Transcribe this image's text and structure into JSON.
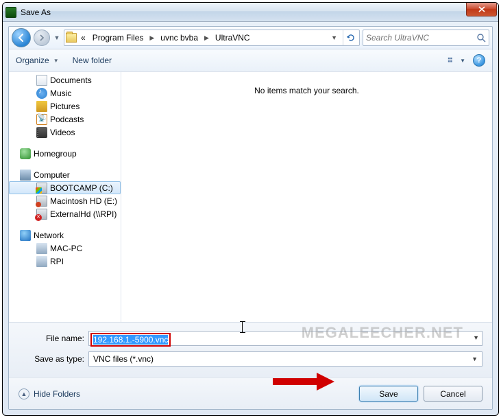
{
  "window": {
    "title": "Save As"
  },
  "breadcrumbs": {
    "prefix": "«",
    "items": [
      "Program Files",
      "uvnc bvba",
      "UltraVNC"
    ]
  },
  "search": {
    "placeholder": "Search UltraVNC"
  },
  "toolbar": {
    "organize": "Organize",
    "newfolder": "New folder"
  },
  "sidebar": {
    "libs": [
      "Documents",
      "Music",
      "Pictures",
      "Podcasts",
      "Videos"
    ],
    "homegroup": "Homegroup",
    "computer": {
      "label": "Computer",
      "drives": [
        "BOOTCAMP (C:)",
        "Macintosh HD (E:)",
        "ExternalHd (\\\\RPI)"
      ]
    },
    "network": {
      "label": "Network",
      "items": [
        "MAC-PC",
        "RPI"
      ]
    }
  },
  "content": {
    "empty": "No items match your search."
  },
  "fields": {
    "filename_label": "File name:",
    "filename_value": "192.168.1.-5900.vnc",
    "savetype_label": "Save as type:",
    "savetype_value": "VNC files (*.vnc)"
  },
  "footer": {
    "hide": "Hide Folders",
    "save": "Save",
    "cancel": "Cancel"
  },
  "watermark": "MEGALEECHER.NET"
}
